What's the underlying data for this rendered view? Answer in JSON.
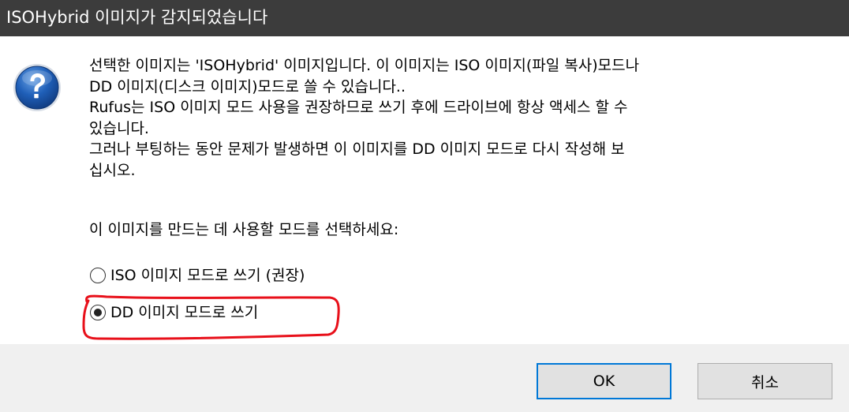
{
  "window": {
    "title": "ISOHybrid 이미지가 감지되었습니다"
  },
  "dialog": {
    "icon": "question-icon",
    "message_lines": [
      "선택한 이미지는 'ISOHybrid' 이미지입니다. 이 이미지는 ISO 이미지(파일 복사)모드나",
      "DD 이미지(디스크 이미지)모드로 쓸 수 있습니다..",
      "Rufus는 ISO 이미지 모드 사용을 권장하므로 쓰기 후에 드라이브에 항상 액세스 할 수",
      "있습니다.",
      "그러나 부팅하는 동안 문제가 발생하면 이 이미지를 DD 이미지 모드로 다시 작성해 보",
      "십시오."
    ],
    "prompt": "이 이미지를 만드는 데 사용할 모드를 선택하세요:",
    "options": [
      {
        "label": "ISO 이미지 모드로 쓰기 (권장)",
        "selected": false
      },
      {
        "label": "DD 이미지 모드로 쓰기",
        "selected": true
      }
    ],
    "highlight_color": "#e8101a"
  },
  "buttons": {
    "ok_label": "OK",
    "cancel_label": "취소"
  },
  "colors": {
    "titlebar": "#3c3c3c",
    "footer": "#f0f0f0",
    "default_button_border": "#0078d7"
  }
}
